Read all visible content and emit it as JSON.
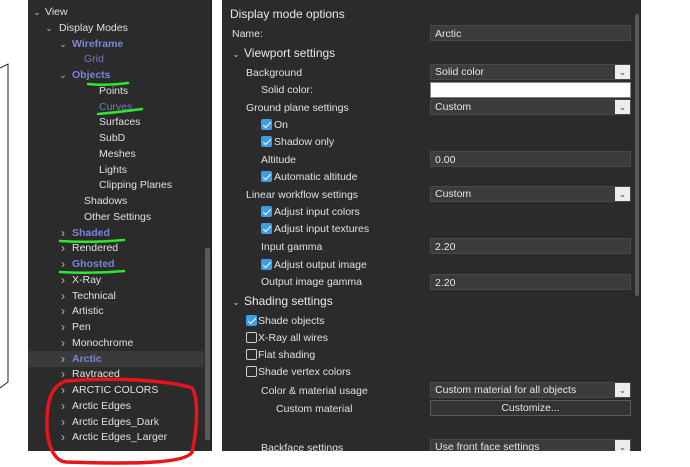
{
  "tree": {
    "items": [
      {
        "label": "View",
        "chevron": "v",
        "style": "normal"
      },
      {
        "label": "Display Modes",
        "chevron": "v",
        "style": "normal"
      },
      {
        "label": "Wireframe",
        "chevron": "v",
        "style": "mode"
      },
      {
        "label": "Grid",
        "chevron": "",
        "style": "dim"
      },
      {
        "label": "Objects",
        "chevron": "v",
        "style": "mode"
      },
      {
        "label": "Points",
        "chevron": "",
        "style": "normal"
      },
      {
        "label": "Curves",
        "chevron": "",
        "style": "dim"
      },
      {
        "label": "Surfaces",
        "chevron": "",
        "style": "normal"
      },
      {
        "label": "SubD",
        "chevron": "",
        "style": "normal"
      },
      {
        "label": "Meshes",
        "chevron": "",
        "style": "normal"
      },
      {
        "label": "Lights",
        "chevron": "",
        "style": "normal"
      },
      {
        "label": "Clipping Planes",
        "chevron": "",
        "style": "normal"
      },
      {
        "label": "Shadows",
        "chevron": "",
        "style": "normal"
      },
      {
        "label": "Other Settings",
        "chevron": "",
        "style": "normal"
      },
      {
        "label": "Shaded",
        "chevron": ">",
        "style": "mode"
      },
      {
        "label": "Rendered",
        "chevron": ">",
        "style": "normal"
      },
      {
        "label": "Ghosted",
        "chevron": ">",
        "style": "mode"
      },
      {
        "label": "X-Ray",
        "chevron": ">",
        "style": "normal"
      },
      {
        "label": "Technical",
        "chevron": ">",
        "style": "normal"
      },
      {
        "label": "Artistic",
        "chevron": ">",
        "style": "normal"
      },
      {
        "label": "Pen",
        "chevron": ">",
        "style": "normal"
      },
      {
        "label": "Monochrome",
        "chevron": ">",
        "style": "normal"
      },
      {
        "label": "Arctic",
        "chevron": ">",
        "style": "mode"
      },
      {
        "label": "Raytraced",
        "chevron": ">",
        "style": "normal"
      },
      {
        "label": "ARCTIC COLORS",
        "chevron": ">",
        "style": "normal"
      },
      {
        "label": "Arctic Edges",
        "chevron": ">",
        "style": "normal"
      },
      {
        "label": "Arctic Edges_Dark",
        "chevron": ">",
        "style": "normal"
      },
      {
        "label": "Arctic Edges_Larger",
        "chevron": ">",
        "style": "normal"
      }
    ]
  },
  "options": {
    "title": "Display mode options",
    "name_label": "Name:",
    "name_value": "Arctic",
    "viewport": {
      "section": "Viewport settings",
      "background_label": "Background",
      "background_value": "Solid color",
      "solid_color_label": "Solid color:",
      "ground_label": "Ground plane settings",
      "ground_value": "Custom",
      "on_label": "On",
      "shadow_only_label": "Shadow only",
      "altitude_label": "Altitude",
      "altitude_value": "0.00",
      "auto_altitude_label": "Automatic altitude",
      "linear_label": "Linear workflow settings",
      "linear_value": "Custom",
      "adjust_input_colors_label": "Adjust input colors",
      "adjust_input_textures_label": "Adjust input textures",
      "input_gamma_label": "Input gamma",
      "input_gamma_value": "2.20",
      "adjust_output_label": "Adjust output image",
      "output_gamma_label": "Output image gamma",
      "output_gamma_value": "2.20"
    },
    "shading": {
      "section": "Shading settings",
      "shade_objects_label": "Shade objects",
      "xray_label": "X-Ray all wires",
      "flat_label": "Flat shading",
      "vertex_label": "Shade vertex colors",
      "color_usage_label": "Color & material usage",
      "color_usage_value": "Custom material for all objects",
      "custom_material_label": "Custom material",
      "customize_button": "Customize...",
      "backface_label": "Backface settings",
      "backface_value": "Use front face settings"
    }
  },
  "colors": {
    "panel_bg": "#2b2b2b",
    "mode_text": "#7a86d8",
    "checkbox_on": "#3d9ee8",
    "highlight_green": "#2ee62e",
    "annotation_red": "#e8141c"
  },
  "icons": {
    "expand": "chevron-down-icon",
    "collapse": "chevron-right-icon",
    "dropdown": "dropdown-arrow-icon",
    "check": "checkmark-icon"
  }
}
